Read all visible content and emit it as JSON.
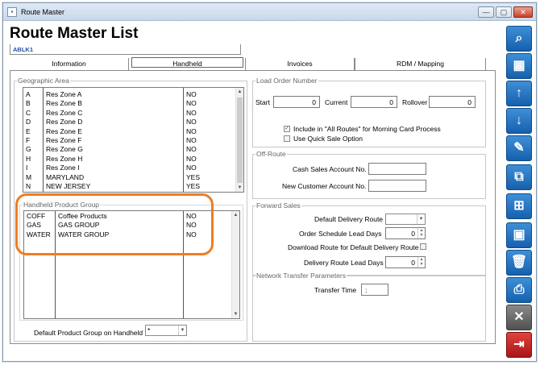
{
  "window": {
    "title": "Route Master",
    "minimize": "—",
    "restore": "▢",
    "close": "✕",
    "icon": "app-icon"
  },
  "page": {
    "title": "Route Master List",
    "route_code": "ABLK1"
  },
  "tabs": [
    {
      "label": "Information"
    },
    {
      "label": "Handheld"
    },
    {
      "label": "Invoices"
    },
    {
      "label": "RDM / Mapping"
    }
  ],
  "geographic": {
    "label": "Geographic Area",
    "rows": [
      {
        "code": "A",
        "name": "Res Zone A",
        "flag": "NO"
      },
      {
        "code": "B",
        "name": "Res Zone B",
        "flag": "NO"
      },
      {
        "code": "C",
        "name": "Res Zone C",
        "flag": "NO"
      },
      {
        "code": "D",
        "name": "Res Zone D",
        "flag": "NO"
      },
      {
        "code": "E",
        "name": "Res Zone E",
        "flag": "NO"
      },
      {
        "code": "F",
        "name": "Res Zone F",
        "flag": "NO"
      },
      {
        "code": "G",
        "name": "Res Zone G",
        "flag": "NO"
      },
      {
        "code": "H",
        "name": "Res Zone H",
        "flag": "NO"
      },
      {
        "code": "I",
        "name": "Res Zone I",
        "flag": "NO"
      },
      {
        "code": "M",
        "name": "MARYLAND",
        "flag": "YES"
      },
      {
        "code": "N",
        "name": "NEW JERSEY",
        "flag": "YES"
      }
    ]
  },
  "handheld_group": {
    "label": "Handheld Product Group",
    "rows": [
      {
        "code": "COFF",
        "name": "Coffee Products",
        "flag": "NO"
      },
      {
        "code": "GAS",
        "name": "GAS GROUP",
        "flag": "NO"
      },
      {
        "code": "WATER",
        "name": "WATER GROUP",
        "flag": "NO"
      }
    ]
  },
  "default_group": {
    "label": "Default Product Group on Handheld",
    "value": "*"
  },
  "load_order": {
    "label": "Load Order Number",
    "start_label": "Start",
    "start_value": "0",
    "current_label": "Current",
    "current_value": "0",
    "rollover_label": "Rollover",
    "rollover_value": "0",
    "include_all_routes": "Include in \"All Routes\" for Morning Card Process",
    "use_quick_sale": "Use Quick Sale Option"
  },
  "off_route": {
    "label": "Off-Route",
    "cash_sales_label": "Cash Sales Account No.",
    "cash_sales_value": "",
    "new_customer_label": "New Customer Account No.",
    "new_customer_value": ""
  },
  "forward_sales": {
    "label": "Forward Sales",
    "default_delivery_label": "Default Delivery Route",
    "default_delivery_value": "",
    "order_lead_label": "Order Schedule Lead Days",
    "order_lead_value": "0",
    "download_route_label": "Download Route for Default Delivery Route",
    "delivery_lead_label": "Delivery Route Lead Days",
    "delivery_lead_value": "0"
  },
  "network": {
    "label": "Network Transfer Parameters",
    "transfer_time_label": "Transfer Time",
    "transfer_time_value": ":"
  },
  "sidebar_buttons": [
    {
      "name": "search-icon",
      "glyph": "⌕"
    },
    {
      "name": "grid-icon",
      "glyph": "▦"
    },
    {
      "name": "arrow-up-icon",
      "glyph": "↑"
    },
    {
      "name": "arrow-down-icon",
      "glyph": "↓"
    },
    {
      "name": "pencil-icon",
      "glyph": "✎"
    },
    {
      "name": "copy-add-icon",
      "glyph": "⧉"
    },
    {
      "name": "save-new-icon",
      "glyph": "⊞"
    },
    {
      "name": "save-icon",
      "glyph": "▣"
    },
    {
      "name": "trash-icon",
      "glyph": "🗑"
    },
    {
      "name": "print-icon",
      "glyph": "⎙"
    },
    {
      "name": "cancel-icon",
      "glyph": "✕"
    },
    {
      "name": "exit-icon",
      "glyph": "⇥"
    }
  ],
  "colors": {
    "accent": "#1a64b0",
    "highlight": "#ef7d22",
    "exit": "#c8232a"
  }
}
